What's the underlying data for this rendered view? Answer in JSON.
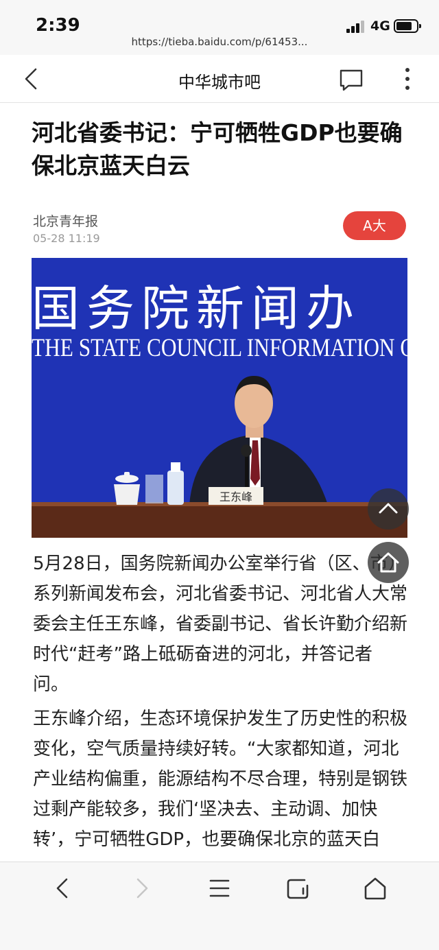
{
  "status_bar": {
    "time": "2:39",
    "network": "4G",
    "url": "https://tieba.baidu.com/p/61453..."
  },
  "nav": {
    "title": "中华城市吧",
    "icons": [
      "back-arrow-icon",
      "comment-icon",
      "more-icon"
    ]
  },
  "article": {
    "headline": "河北省委书记：宁可牺牲GDP也要确保北京蓝天白云",
    "source": "北京青年报",
    "time": "05-28 11:19",
    "font_button": "A大",
    "image": {
      "banner_cn": "国务院新闻办",
      "banner_en": "THE STATE COUNCIL INFORMATION O",
      "nameplate": "王东峰"
    },
    "paragraphs": [
      "5月28日，国务院新闻办公室举行省（区、市）系列新闻发布会，河北省委书记、河北省人大常委会主任王东峰，省委副书记、省长许勤介绍新时代“赶考”路上砥砺奋进的河北，并答记者问。",
      "王东峰介绍，生态环境保护发生了历史性的积极变化，空气质量持续好转。“大家都知道，河北产业结构偏重，能源结构不尽合理，特别是钢铁过剩产能较多，我们‘坚决去、主动调、加快转’，宁可牺牲GDP，也要确保北京的蓝天白云。”"
    ]
  },
  "floating_buttons": [
    "back-to-top",
    "home"
  ],
  "toolbar": {
    "icons": [
      "back-icon",
      "forward-icon",
      "menu-icon",
      "tabs-icon",
      "home-icon"
    ]
  },
  "colors": {
    "accent": "#e5443d",
    "banner_blue": "#1f33b5"
  }
}
